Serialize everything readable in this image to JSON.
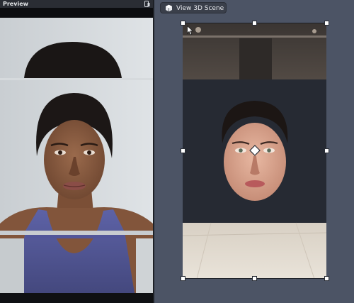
{
  "preview": {
    "title": "Preview",
    "icon": "phone-icon"
  },
  "toolbar": {
    "view3d_label": "View 3D Scene",
    "view3d_icon": "cube-icon"
  },
  "colors": {
    "scene_bg": "#4c5465",
    "panel_bg": "#16181c",
    "header_bg": "#2a2d34",
    "scene_card_bg": "#262a33",
    "accent_tank_top": "#5b5fa0"
  }
}
